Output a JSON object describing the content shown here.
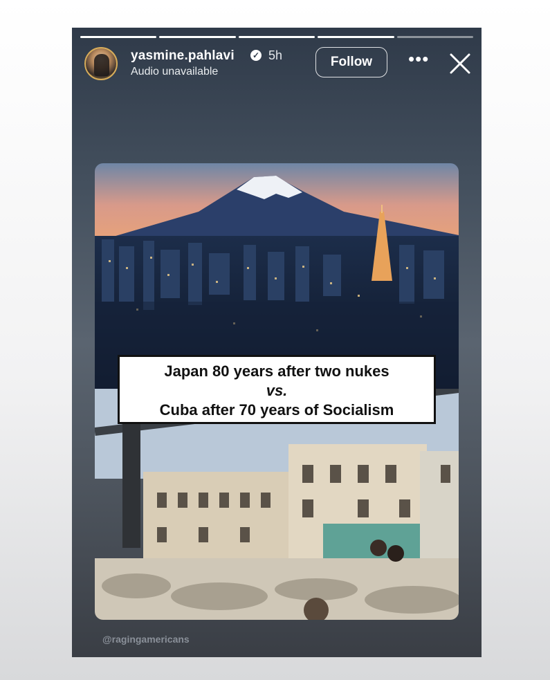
{
  "story": {
    "progress_segments": 5,
    "progress_done": 4,
    "username": "yasmine.pahlavi",
    "time_ago": "5h",
    "audio_status": "Audio unavailable",
    "follow_label": "Follow",
    "more_label": "•••"
  },
  "post": {
    "caption_line1": "Japan 80 years after two nukes",
    "caption_line2": "vs.",
    "caption_line3": "Cuba after 70 years of Socialism",
    "watermark": "@ragingamericans"
  }
}
